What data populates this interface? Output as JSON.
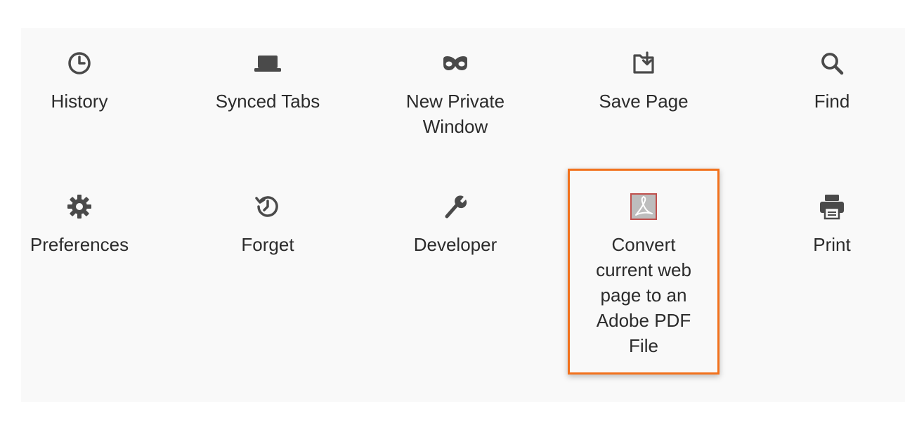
{
  "menu": {
    "items": [
      {
        "label": "History",
        "icon": "clock-icon"
      },
      {
        "label": "Synced Tabs",
        "icon": "laptop-icon"
      },
      {
        "label": "New Private\nWindow",
        "icon": "mask-icon"
      },
      {
        "label": "Save Page",
        "icon": "save-page-icon"
      },
      {
        "label": "Find",
        "icon": "search-icon"
      },
      {
        "label": "Preferences",
        "icon": "gear-icon"
      },
      {
        "label": "Forget",
        "icon": "forget-icon"
      },
      {
        "label": "Developer",
        "icon": "wrench-icon"
      },
      {
        "label": "Convert\ncurrent web\npage to an\nAdobe PDF\nFile",
        "icon": "adobe-pdf-icon"
      },
      {
        "label": "Print",
        "icon": "printer-icon"
      }
    ]
  },
  "colors": {
    "highlight": "#f2711c",
    "icon": "#4a4a4a",
    "pdf_icon_bg": "#c0504d",
    "panel_bg": "#f9f9f9"
  }
}
